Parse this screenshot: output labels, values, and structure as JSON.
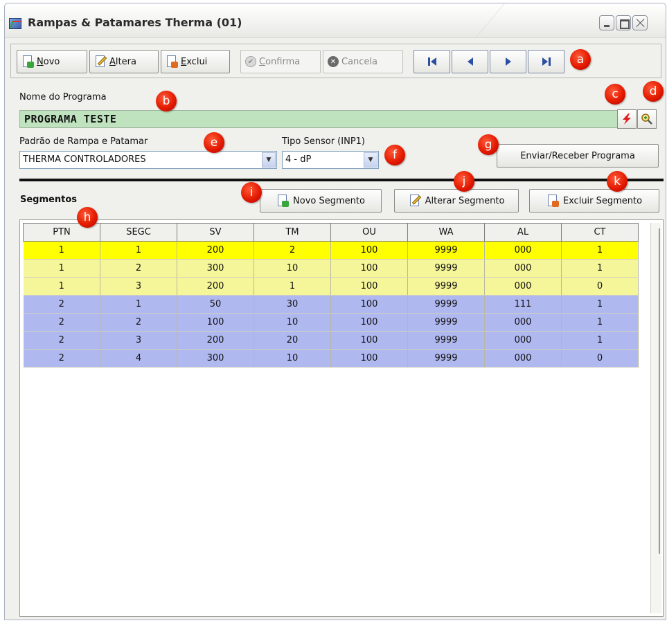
{
  "window": {
    "title": "Rampas & Patamares Therma (01)"
  },
  "toolbar": {
    "novo": "Novo",
    "altera": "Altera",
    "exclui": "Exclui",
    "confirma": "Confirma",
    "cancela": "Cancela"
  },
  "markers": {
    "a": "a",
    "b": "b",
    "c": "c",
    "d": "d",
    "e": "e",
    "f": "f",
    "g": "g",
    "h": "h",
    "i": "i",
    "j": "j",
    "k": "k"
  },
  "programa": {
    "label": "Nome do Programa",
    "value": "PROGRAMA TESTE"
  },
  "padrao": {
    "label": "Padrão de Rampa e Patamar",
    "value": "THERMA CONTROLADORES"
  },
  "sensor": {
    "label": "Tipo Sensor (INP1)",
    "value": "4 - dP"
  },
  "enviar_receber": "Enviar/Receber Programa",
  "segmentos": {
    "label": "Segmentos",
    "novo": "Novo Segmento",
    "alterar": "Alterar Segmento",
    "excluir": "Excluir Segmento"
  },
  "table": {
    "columns": [
      "PTN",
      "SEGC",
      "SV",
      "TM",
      "OU",
      "WA",
      "AL",
      "CT"
    ],
    "rows": [
      [
        "1",
        "1",
        "200",
        "2",
        "100",
        "9999",
        "000",
        "1"
      ],
      [
        "1",
        "2",
        "300",
        "10",
        "100",
        "9999",
        "000",
        "1"
      ],
      [
        "1",
        "3",
        "200",
        "1",
        "100",
        "9999",
        "000",
        "0"
      ],
      [
        "2",
        "1",
        "50",
        "30",
        "100",
        "9999",
        "111",
        "1"
      ],
      [
        "2",
        "2",
        "100",
        "10",
        "100",
        "9999",
        "000",
        "1"
      ],
      [
        "2",
        "3",
        "200",
        "20",
        "100",
        "9999",
        "000",
        "1"
      ],
      [
        "2",
        "4",
        "300",
        "10",
        "100",
        "9999",
        "000",
        "0"
      ]
    ],
    "row_colors": [
      "#ffff00",
      "#f5f59a",
      "#f5f59a",
      "#b0b8f0",
      "#b0b8f0",
      "#b0b8f0",
      "#b0b8f0"
    ]
  },
  "colors": {
    "marker": "#e41b00",
    "name_field": "#bfe2bf",
    "selected_row": "#ffff00",
    "program1_row": "#f5f59a",
    "program2_row": "#b0b8f0"
  }
}
